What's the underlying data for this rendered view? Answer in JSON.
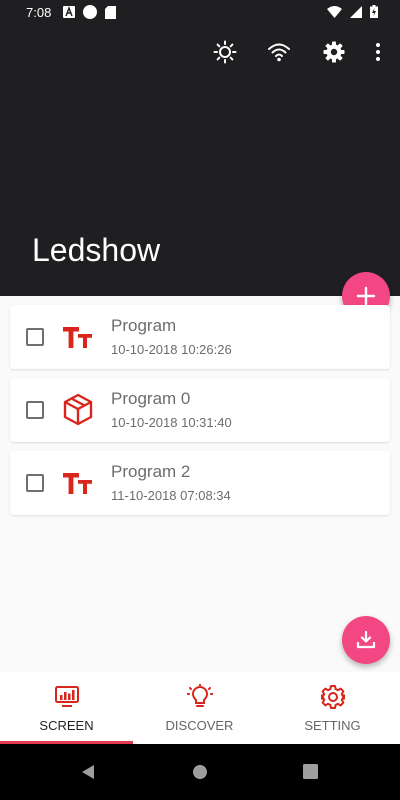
{
  "status_bar": {
    "time": "7:08"
  },
  "header": {
    "title": "Ledshow"
  },
  "programs": [
    {
      "name": "Program",
      "date": "10-10-2018 10:26:26",
      "icon": "text-icon"
    },
    {
      "name": "Program 0",
      "date": "10-10-2018 10:31:40",
      "icon": "cube-icon"
    },
    {
      "name": "Program 2",
      "date": "11-10-2018 07:08:34",
      "icon": "text-icon"
    }
  ],
  "bottom_nav": [
    {
      "label": "SCREEN",
      "icon": "chart-monitor-icon",
      "active": true
    },
    {
      "label": "DISCOVER",
      "icon": "lightbulb-icon",
      "active": false
    },
    {
      "label": "SETTING",
      "icon": "gear-icon",
      "active": false
    }
  ],
  "colors": {
    "accent": "#f24782",
    "icon_red": "#d9261c",
    "header_bg": "#1f1e21"
  }
}
